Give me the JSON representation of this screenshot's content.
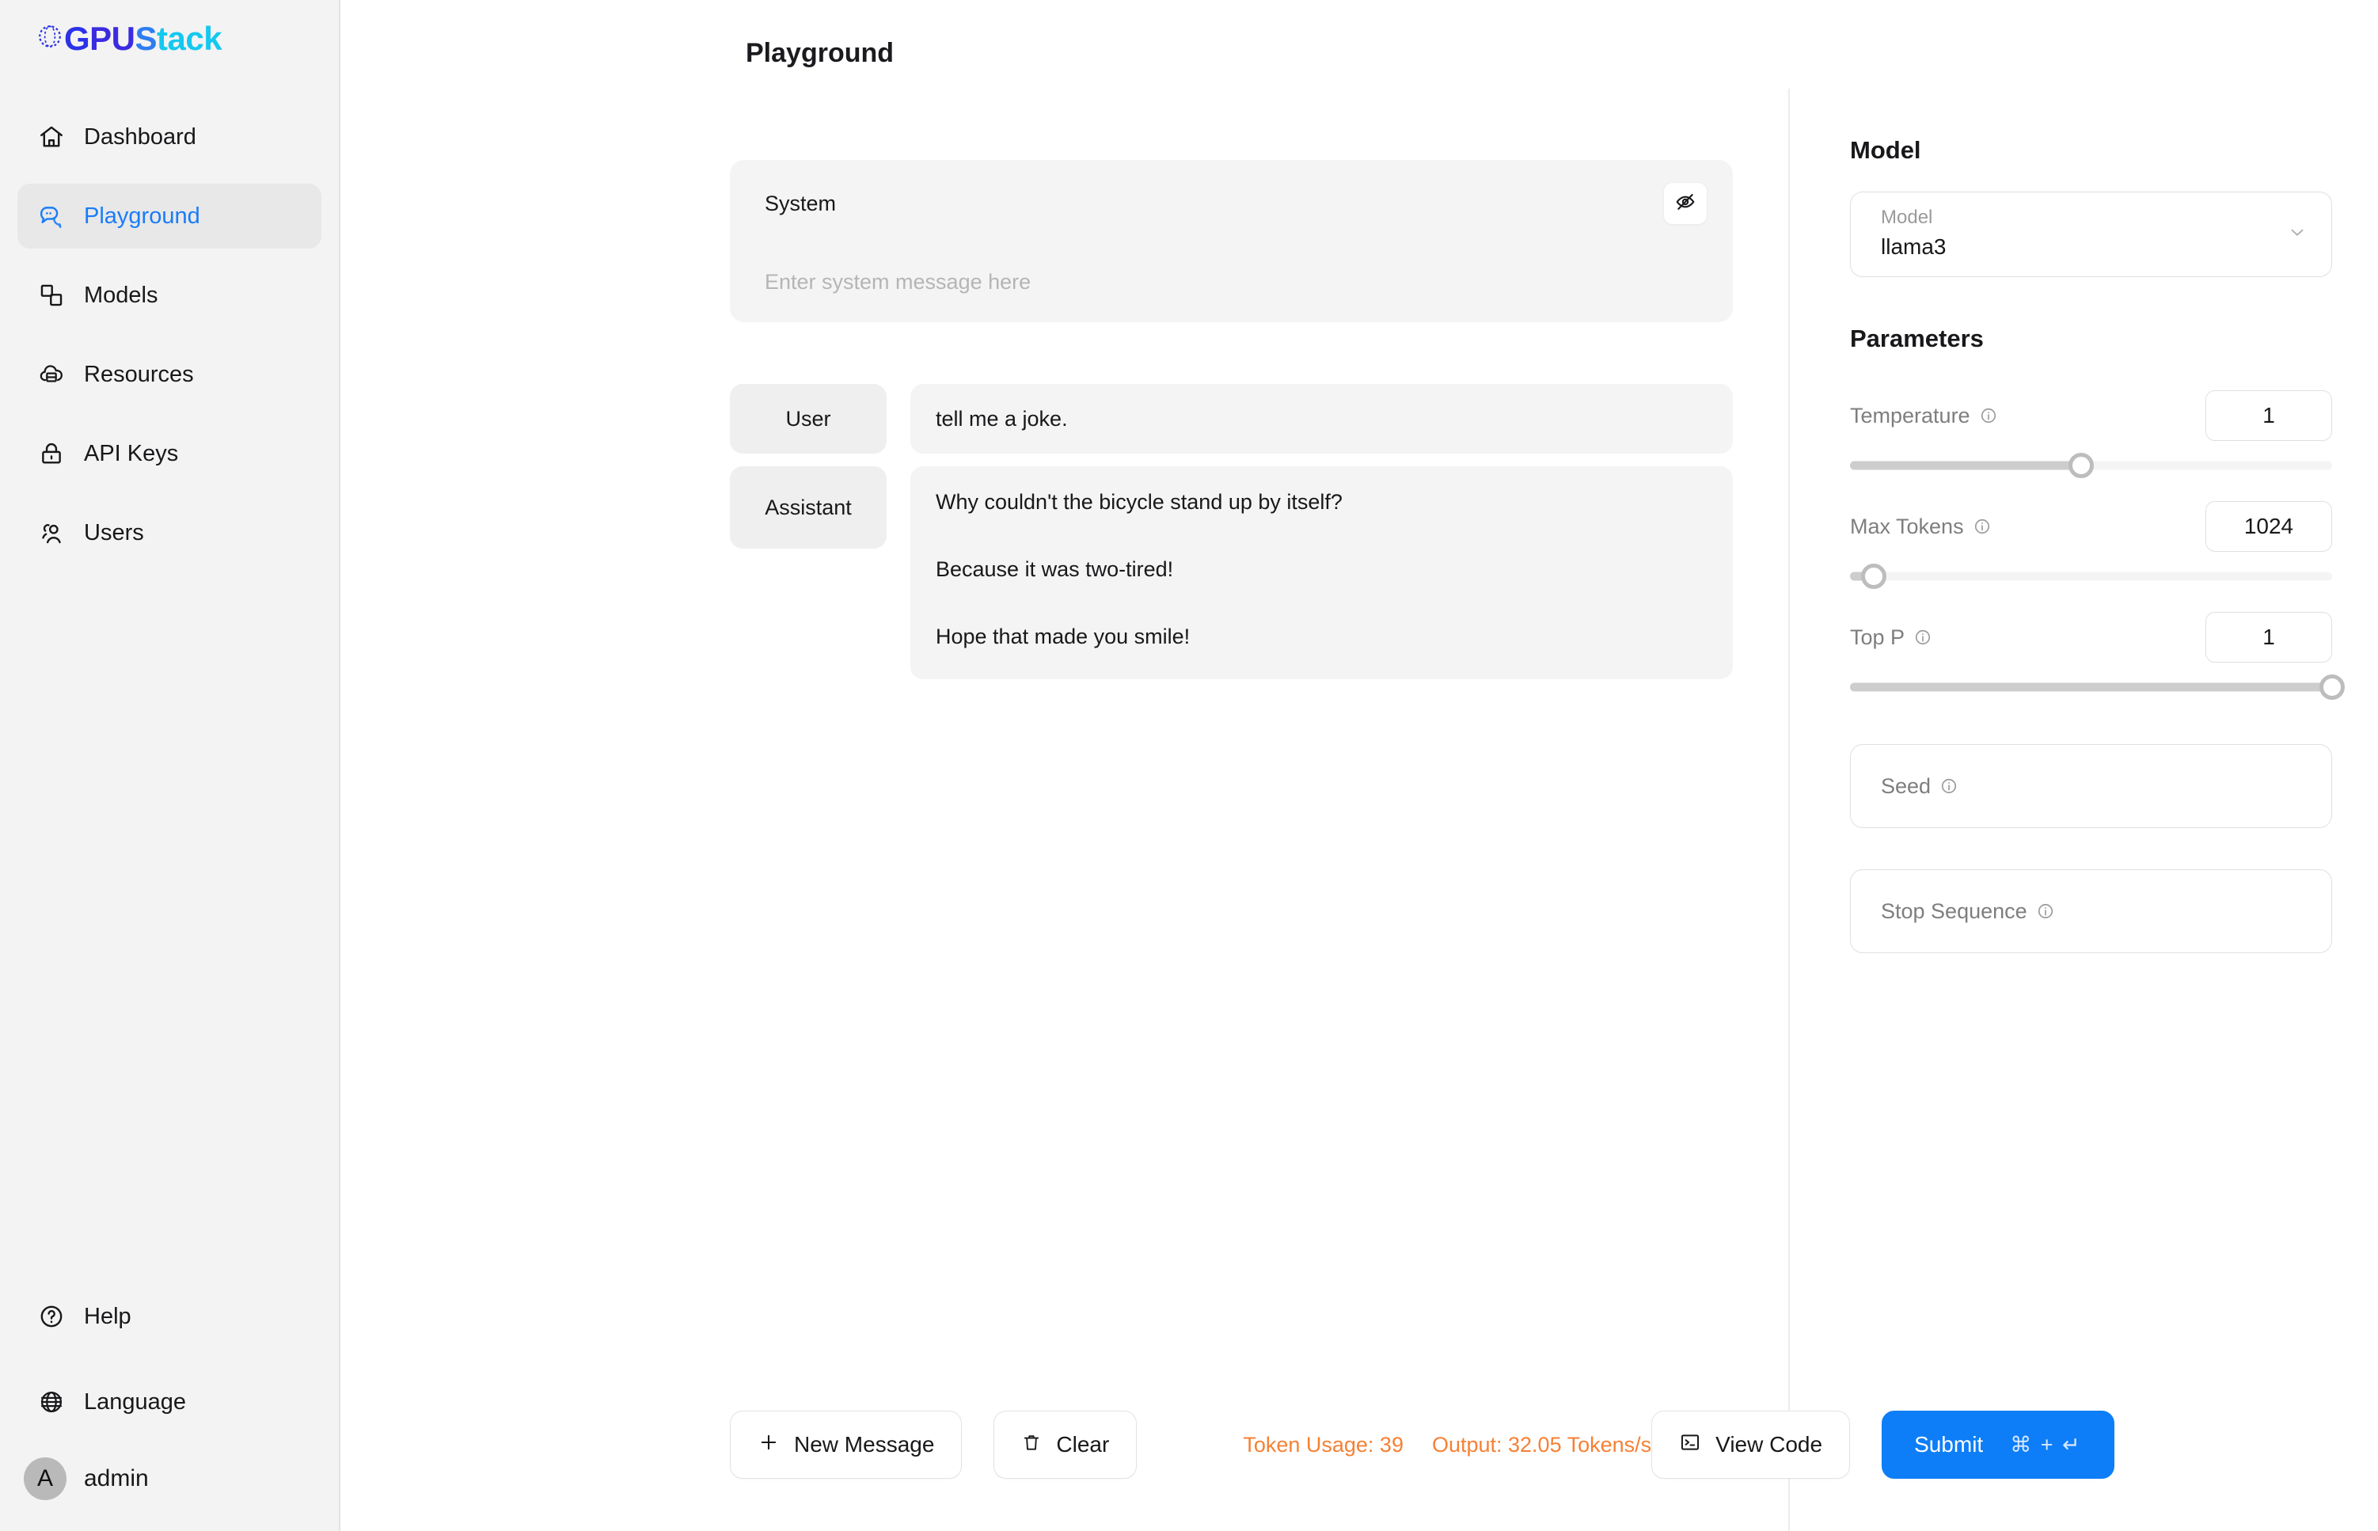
{
  "brand": {
    "logo_parts": [
      "G",
      "PU",
      "S",
      "tack"
    ],
    "accent_start": "#2b32e8",
    "accent_end": "#14c8ef"
  },
  "sidebar": {
    "items": [
      {
        "label": "Dashboard",
        "icon": "home-icon",
        "active": false
      },
      {
        "label": "Playground",
        "icon": "chat-bubble-icon",
        "active": true
      },
      {
        "label": "Models",
        "icon": "layers-icon",
        "active": false
      },
      {
        "label": "Resources",
        "icon": "cloud-server-icon",
        "active": false
      },
      {
        "label": "API Keys",
        "icon": "lock-icon",
        "active": false
      },
      {
        "label": "Users",
        "icon": "users-icon",
        "active": false
      }
    ],
    "bottom_items": [
      {
        "label": "Help",
        "icon": "question-circle-icon"
      },
      {
        "label": "Language",
        "icon": "globe-icon"
      }
    ],
    "user": {
      "initial": "A",
      "name": "admin"
    }
  },
  "header": {
    "title": "Playground"
  },
  "system": {
    "label": "System",
    "placeholder": "Enter system message here",
    "value": "",
    "toggle_icon": "eye-invisible-icon"
  },
  "messages": [
    {
      "role": "User",
      "paragraphs": [
        "tell me a joke."
      ]
    },
    {
      "role": "Assistant",
      "paragraphs": [
        "Why couldn't the bicycle stand up by itself?",
        "Because it was two-tired!",
        "Hope that made you smile!"
      ]
    }
  ],
  "toolbar": {
    "new_message_label": "New Message",
    "clear_label": "Clear",
    "token_usage": "Token Usage: 39",
    "output_rate": "Output: 32.05 Tokens/s",
    "view_code_label": "View Code",
    "submit_label": "Submit",
    "submit_shortcut": "⌘ + ↵",
    "usage_color": "#f58134",
    "submit_color": "#0d7ef7"
  },
  "right_panel": {
    "model_heading": "Model",
    "model_select": {
      "label": "Model",
      "value": "llama3"
    },
    "parameters_heading": "Parameters",
    "parameters": [
      {
        "label": "Temperature",
        "value": "1",
        "percent": 48
      },
      {
        "label": "Max Tokens",
        "value": "1024",
        "percent": 5
      },
      {
        "label": "Top P",
        "value": "1",
        "percent": 100
      }
    ],
    "fields": [
      {
        "label": "Seed",
        "value": ""
      },
      {
        "label": "Stop Sequence",
        "value": ""
      }
    ]
  }
}
